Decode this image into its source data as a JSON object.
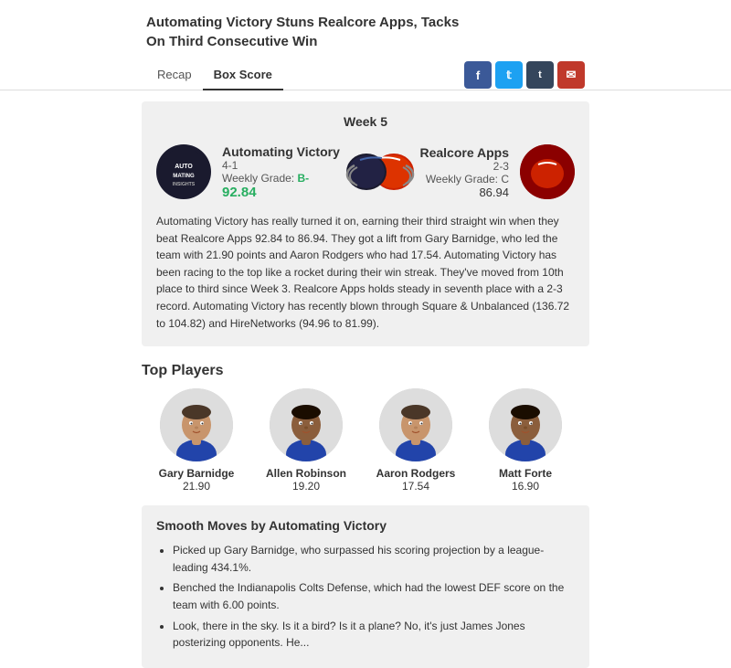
{
  "page": {
    "headline": "Automating Victory Stuns Realcore Apps, Tacks\nOn Third Consecutive Win"
  },
  "tabs": {
    "recap_label": "Recap",
    "boxscore_label": "Box Score"
  },
  "social": {
    "facebook": "f",
    "twitter": "t",
    "tumblr": "t",
    "email": "✉"
  },
  "matchup": {
    "week_label": "Week 5",
    "team1": {
      "name": "Automating Victory",
      "record": "4-1",
      "grade_label": "Weekly Grade:",
      "grade": "B-",
      "score": "92.84"
    },
    "team2": {
      "name": "Realcore Apps",
      "record": "2-3",
      "grade_label": "Weekly Grade:",
      "grade": "C",
      "score": "86.94"
    },
    "description": "Automating Victory has really turned it on, earning their third straight win when they beat Realcore Apps 92.84 to 86.94. They got a lift from Gary Barnidge, who led the team with 21.90 points and Aaron Rodgers who had 17.54. Automating Victory has been racing to the top like a rocket during their win streak. They've moved from 10th place to third since Week 3. Realcore Apps holds steady in seventh place with a 2-3 record. Automating Victory has recently blown through Square & Unbalanced (136.72 to 104.82) and HireNetworks (94.96 to 81.99)."
  },
  "top_players": {
    "section_title": "Top Players",
    "players": [
      {
        "name": "Gary Barnidge",
        "score": "21.90",
        "skin": "#c8956c"
      },
      {
        "name": "Allen Robinson",
        "score": "19.20",
        "skin": "#8b5e3c"
      },
      {
        "name": "Aaron Rodgers",
        "score": "17.54",
        "skin": "#c8956c"
      },
      {
        "name": "Matt Forte",
        "score": "16.90",
        "skin": "#8b5e3c"
      }
    ]
  },
  "smooth_moves": {
    "title": "Smooth Moves by Automating Victory",
    "items": [
      "Picked up Gary Barnidge, who surpassed his scoring projection by a league-leading 434.1%.",
      "Benched the Indianapolis Colts Defense, which had the lowest DEF score on the team with 6.00 points.",
      "Look, there in the sky. Is it a bird? Is it a plane? No, it's just James Jones posterizing opponents. He..."
    ]
  }
}
